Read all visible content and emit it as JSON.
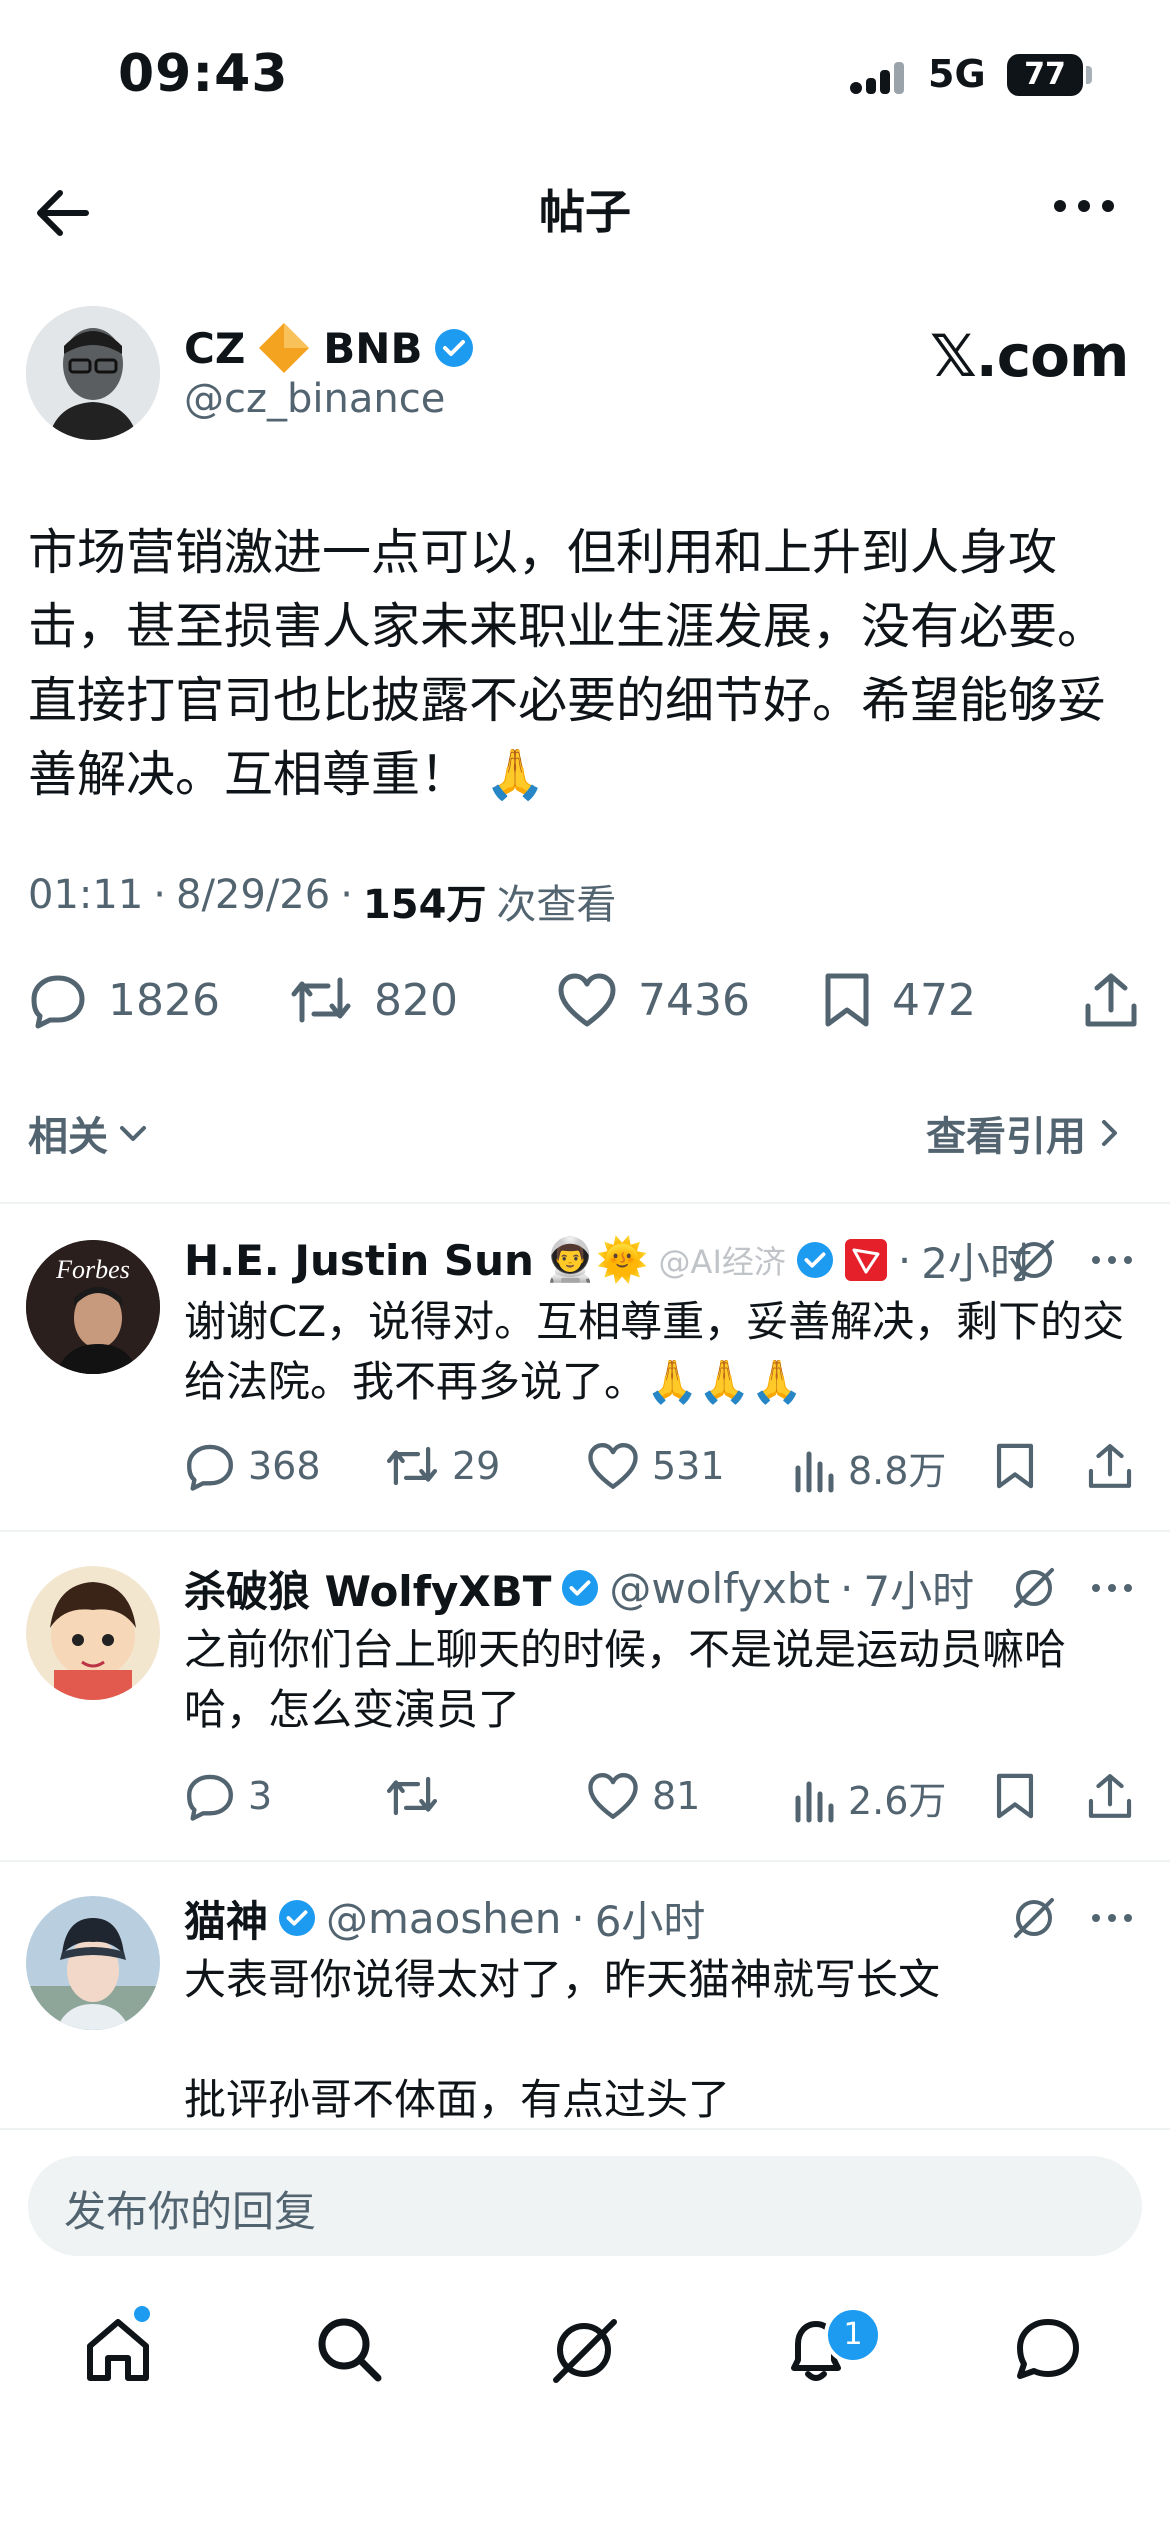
{
  "status_bar": {
    "time": "09:43",
    "network": "5G",
    "battery": "77"
  },
  "header": {
    "title": "帖子"
  },
  "post": {
    "author_name": "CZ",
    "author_suffix": "BNB",
    "handle": "@cz_binance",
    "source_logo": "𝕏.com",
    "text": "市场营销激进一点可以，但利用和上升到人身攻击，甚至损害人家未来职业生涯发展，没有必要。直接打官司也比披露不必要的细节好。希望能够妥善解决。互相尊重！ 🙏",
    "time": "01:11",
    "date": "8/29/26",
    "views": "154万",
    "views_label": "次查看",
    "counts": {
      "replies": "1826",
      "reposts": "820",
      "likes": "7436",
      "bookmarks": "472"
    },
    "related_label": "相关",
    "quotes_label": "查看引用"
  },
  "replies": [
    {
      "name": "H.E. Justin Sun",
      "name_extras": "👨‍🚀🌞",
      "handle": "",
      "time": "2小时",
      "text": "谢谢CZ，说得对。互相尊重，妥善解决，剩下的交给法院。我不再多说了。🙏🙏🙏",
      "replies": "368",
      "reposts": "29",
      "likes": "531",
      "views": "8.8万",
      "avatar_text": "Forbes"
    },
    {
      "name": "杀破狼 WolfyXBT",
      "handle": "@wolfyxbt",
      "time": "7小时",
      "text": "之前你们台上聊天的时候，不是说是运动员嘛哈哈，怎么变演员了",
      "replies": "3",
      "reposts": "",
      "likes": "81",
      "views": "2.6万"
    },
    {
      "name": "猫神",
      "handle": "@maoshen",
      "time": "6小时",
      "text": "大表哥你说得太对了，昨天猫神就写长文",
      "text2": "批评孙哥不体面，有点过头了"
    }
  ],
  "watermark": "@AI经济",
  "composer": {
    "placeholder": "发布你的回复"
  },
  "tabbar": {
    "notifications_badge": "1"
  },
  "icons": [
    "back-arrow-icon",
    "more-icon",
    "verified-badge-icon",
    "orange-diamond-icon",
    "reply-icon",
    "repost-icon",
    "like-icon",
    "bookmark-icon",
    "share-icon",
    "views-icon",
    "grok-icon",
    "home-icon",
    "search-icon",
    "notifications-icon",
    "messages-icon",
    "chevron-down-icon",
    "chevron-right-icon"
  ],
  "colors": {
    "accent": "#1d9bf0",
    "muted": "#536471",
    "text": "#0f1419",
    "divider": "#eff3f4",
    "bnb": "#f3a31f",
    "tron_red": "#e5202a"
  }
}
